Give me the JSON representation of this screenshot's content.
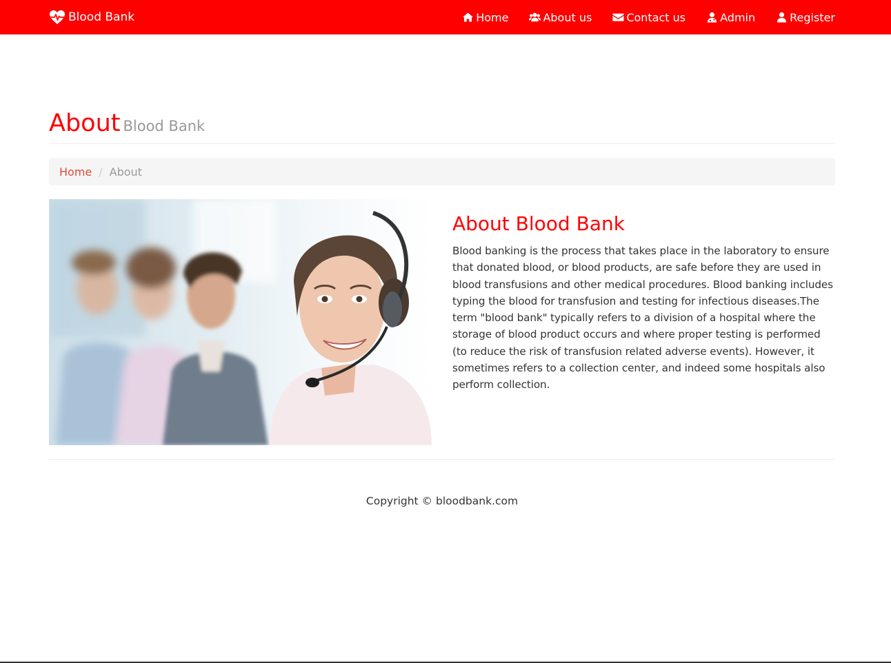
{
  "brand": {
    "name": "Blood Bank",
    "icon": "heartbeat-icon",
    "color": "#ff0000"
  },
  "nav": {
    "items": [
      {
        "label": "Home",
        "icon": "home-icon"
      },
      {
        "label": "About us",
        "icon": "users-icon"
      },
      {
        "label": "Contact us",
        "icon": "envelope-icon"
      },
      {
        "label": "Admin",
        "icon": "user-md-icon"
      },
      {
        "label": "Register",
        "icon": "user-icon"
      }
    ]
  },
  "header": {
    "title": "About",
    "subtitle": "Blood Bank"
  },
  "breadcrumb": {
    "home": "Home",
    "separator": "/",
    "current": "About"
  },
  "about": {
    "heading": "About Blood Bank",
    "text": "Blood banking is the process that takes place in the laboratory to ensure that donated blood, or blood products, are safe before they are used in blood transfusions and other medical procedures. Blood banking includes typing the blood for transfusion and testing for infectious diseases.The term \"blood bank\" typically refers to a division of a hospital where the storage of blood product occurs and where proper testing is performed (to reduce the risk of transfusion related adverse events). However, it sometimes refers to a collection center, and indeed some hospitals also perform collection."
  },
  "footer": {
    "copyright": "Copyright © bloodbank.com"
  }
}
